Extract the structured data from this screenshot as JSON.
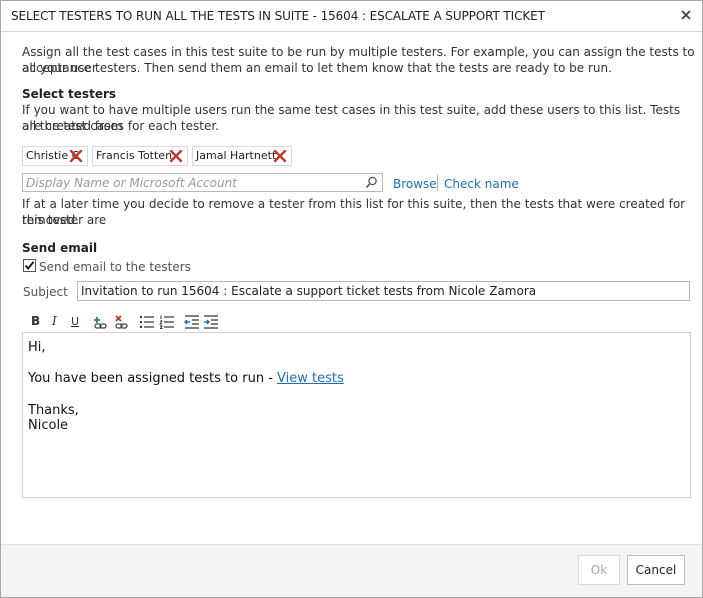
{
  "dialog": {
    "title": "SELECT TESTERS TO RUN ALL THE TESTS IN SUITE - 15604 : ESCALATE A SUPPORT TICKET",
    "close_icon": "close-icon"
  },
  "intro": {
    "line1": "Assign all the test cases in this test suite to be run by multiple testers. For example, you can assign the tests to all your user",
    "line2": "acceptance testers. Then send them an email to let them know that the tests are ready to be run."
  },
  "select_testers": {
    "heading": "Select testers",
    "desc_line1": "If you want to have multiple users run the same test cases in this test suite, add these users to this list. Tests are created from",
    "desc_line2": "all the test cases for each tester.",
    "testers": [
      {
        "name": "Christie C"
      },
      {
        "name": "Francis Totten"
      },
      {
        "name": "Jamal Hartnett"
      }
    ],
    "picker_placeholder": "Display Name or Microsoft Account",
    "browse_label": "Browse",
    "check_name_label": "Check name",
    "note_line1": "If at a later time you decide to remove a tester from this list for this suite, then the tests that were created for this tester are",
    "note_line2": "removed."
  },
  "send_email": {
    "heading": "Send email",
    "checkbox_label": "Send email to the testers",
    "checked": true,
    "subject_label": "Subject",
    "subject_value": "Invitation to run 15604 : Escalate a support ticket tests from Nicole Zamora",
    "toolbar": [
      "bold-icon",
      "italic-icon",
      "underline-icon",
      "insert-link-icon",
      "remove-link-icon",
      "bulleted-list-icon",
      "numbered-list-icon",
      "decrease-indent-icon",
      "increase-indent-icon"
    ],
    "toolbar_letters": {
      "bold": "B",
      "italic": "I",
      "underline": "U"
    },
    "body": {
      "greeting": "Hi,",
      "assigned_prefix": "You have been assigned tests to run - ",
      "view_tests_link": "View tests",
      "closing": "Thanks,",
      "signature": "Nicole"
    }
  },
  "footer": {
    "ok_label": "Ok",
    "cancel_label": "Cancel"
  },
  "colors": {
    "link": "#1d6fb7",
    "remove_x": "#c0392b",
    "footer_bg": "#f4f4f4"
  }
}
